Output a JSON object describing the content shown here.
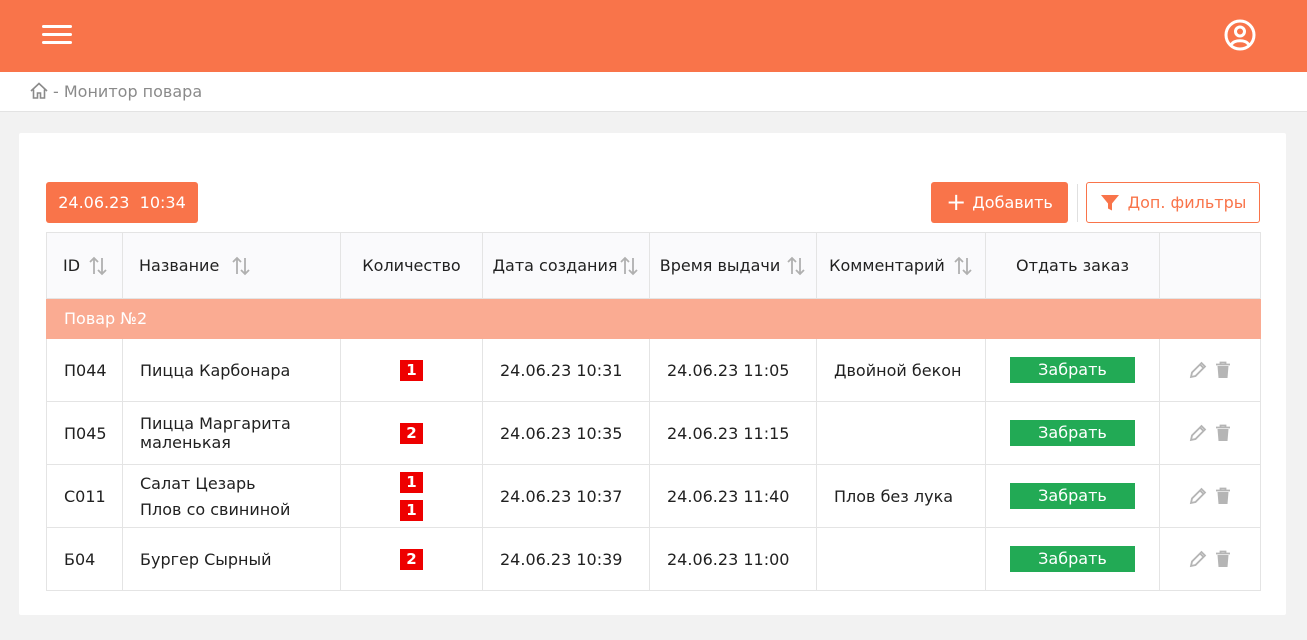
{
  "breadcrumb": {
    "separator": "-",
    "current": "Монитор повара"
  },
  "toolbar": {
    "datetime": "24.06.23  10:34",
    "add_label": "Добавить",
    "filters_label": "Доп. фильтры"
  },
  "table": {
    "headers": {
      "id": "ID",
      "name": "Название",
      "qty": "Количество",
      "created": "Дата создания",
      "issued": "Время выдачи",
      "comment": "Комментарий",
      "give": "Отдать заказ"
    },
    "group": "Повар №2",
    "rows": [
      {
        "id": "П044",
        "items": [
          {
            "name": "Пицца Карбонара",
            "qty": "1"
          }
        ],
        "created": "24.06.23 10:31",
        "issued": "24.06.23 11:05",
        "comment": "Двойной бекон",
        "action": "Забрать"
      },
      {
        "id": "П045",
        "items": [
          {
            "name": "Пицца Маргарита маленькая",
            "qty": "2"
          }
        ],
        "created": "24.06.23 10:35",
        "issued": "24.06.23 11:15",
        "comment": "",
        "action": "Забрать"
      },
      {
        "id": "С011",
        "items": [
          {
            "name": "Салат Цезарь",
            "qty": "1"
          },
          {
            "name": "Плов со свининой",
            "qty": "1"
          }
        ],
        "created": "24.06.23 10:37",
        "issued": "24.06.23 11:40",
        "comment": "Плов без лука",
        "action": "Забрать"
      },
      {
        "id": "Б04",
        "items": [
          {
            "name": "Бургер Сырный",
            "qty": "2"
          }
        ],
        "created": "24.06.23 10:39",
        "issued": "24.06.23 11:00",
        "comment": "",
        "action": "Забрать"
      }
    ]
  },
  "colors": {
    "brand": "#f9744a",
    "group_row": "#faab92",
    "qty_badge": "#ee0000",
    "take_button": "#22aa55"
  },
  "icons": [
    "menu-icon",
    "user-icon",
    "home-icon",
    "plus-icon",
    "filter-icon",
    "sort-icon",
    "pencil-icon",
    "trash-icon"
  ]
}
